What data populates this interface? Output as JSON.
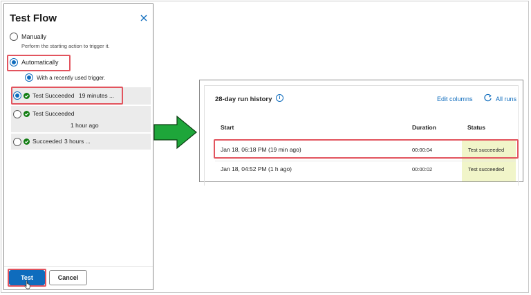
{
  "left_panel": {
    "title": "Test Flow",
    "options": {
      "manual_label": "Manually",
      "manual_sub": "Perform the starting action to trigger it.",
      "auto_label": "Automatically",
      "recent_label": "With a recently used trigger."
    },
    "runs": [
      {
        "status": "Test Succeeded",
        "time": "19 minutes ...",
        "selected": true
      },
      {
        "status": "Test Succeeded",
        "time": "1 hour ago",
        "selected": false
      },
      {
        "status": "Succeeded",
        "time": "3 hours ...",
        "selected": false
      }
    ],
    "buttons": {
      "test": "Test",
      "cancel": "Cancel"
    }
  },
  "run_history": {
    "title": "28-day run history",
    "edit_columns": "Edit columns",
    "all_runs": "All runs",
    "columns": [
      "Start",
      "Duration",
      "Status"
    ],
    "rows": [
      {
        "start": "Jan 18, 06:18 PM (19 min ago)",
        "duration": "00:00:04",
        "status": "Test succeeded"
      },
      {
        "start": "Jan 18, 04:52 PM (1 h ago)",
        "duration": "00:00:02",
        "status": "Test succeeded"
      }
    ]
  },
  "colors": {
    "accent": "#0f6cbd",
    "success": "#107c10",
    "highlight": "#e2545e",
    "arrow": "#1ea63a",
    "status_bg": "#f1f5c9"
  },
  "icons": {
    "close": "close-icon",
    "check": "check-circle-icon",
    "info": "info-icon",
    "refresh": "refresh-icon",
    "arrow": "arrow-right-icon",
    "cursor": "hand-cursor-icon"
  }
}
